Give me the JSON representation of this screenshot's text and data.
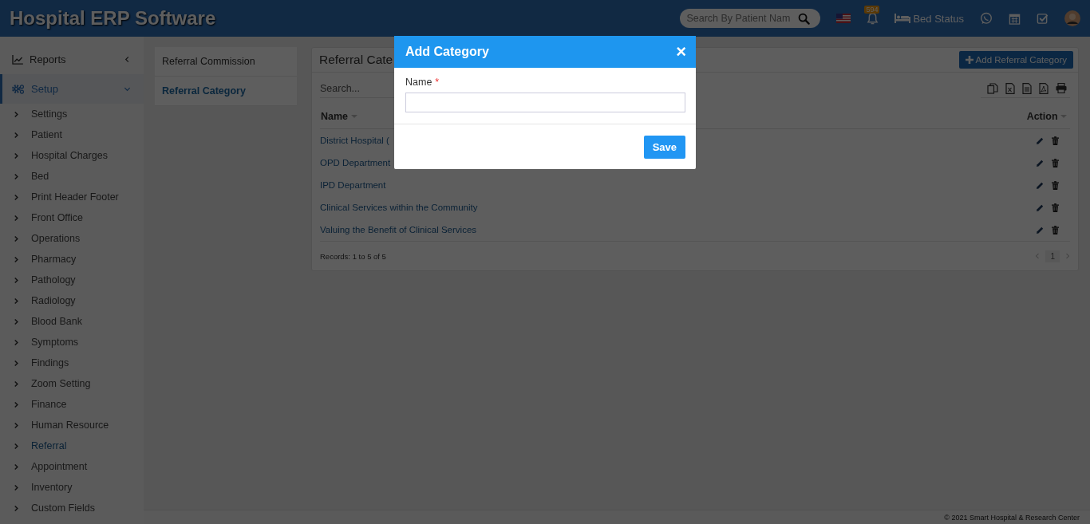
{
  "header": {
    "title": "Hospital ERP Software",
    "search": {
      "placeholder": "Search By Patient Nam"
    },
    "notification_count": "594",
    "bed_status": "Bed Status"
  },
  "sidebar": {
    "items": [
      {
        "label": "Reports",
        "selected": false,
        "expanded": false
      },
      {
        "label": "Setup",
        "selected": true,
        "expanded": true,
        "children": [
          {
            "label": "Settings",
            "selected": false
          },
          {
            "label": "Patient",
            "selected": false
          },
          {
            "label": "Hospital Charges",
            "selected": false
          },
          {
            "label": "Bed",
            "selected": false
          },
          {
            "label": "Print Header Footer",
            "selected": false
          },
          {
            "label": "Front Office",
            "selected": false
          },
          {
            "label": "Operations",
            "selected": false
          },
          {
            "label": "Pharmacy",
            "selected": false
          },
          {
            "label": "Pathology",
            "selected": false
          },
          {
            "label": "Radiology",
            "selected": false
          },
          {
            "label": "Blood Bank",
            "selected": false
          },
          {
            "label": "Symptoms",
            "selected": false
          },
          {
            "label": "Findings",
            "selected": false
          },
          {
            "label": "Zoom Setting",
            "selected": false
          },
          {
            "label": "Finance",
            "selected": false
          },
          {
            "label": "Human Resource",
            "selected": false
          },
          {
            "label": "Referral",
            "selected": true
          },
          {
            "label": "Appointment",
            "selected": false
          },
          {
            "label": "Inventory",
            "selected": false
          },
          {
            "label": "Custom Fields",
            "selected": false
          }
        ]
      }
    ]
  },
  "tabs": [
    {
      "label": "Referral Commission",
      "selected": false
    },
    {
      "label": "Referral Category",
      "selected": true
    }
  ],
  "panel": {
    "title": "Referral Cate",
    "add_button": "Add Referral Category",
    "search": {
      "placeholder": "Search..."
    },
    "columns": [
      "Name",
      "Action"
    ],
    "rows": [
      "District Hospital (",
      "OPD Department",
      "IPD Department",
      "Clinical Services within the Community",
      "Valuing the Benefit of Clinical Services"
    ],
    "records": "Records: 1 to 5 of 5",
    "page": "1"
  },
  "modal": {
    "title": "Add Category",
    "close": "×",
    "field": {
      "label": "Name",
      "required_mark": "*"
    },
    "save": "Save"
  },
  "footer": "© 2021 Smart Hospital & Research Center"
}
